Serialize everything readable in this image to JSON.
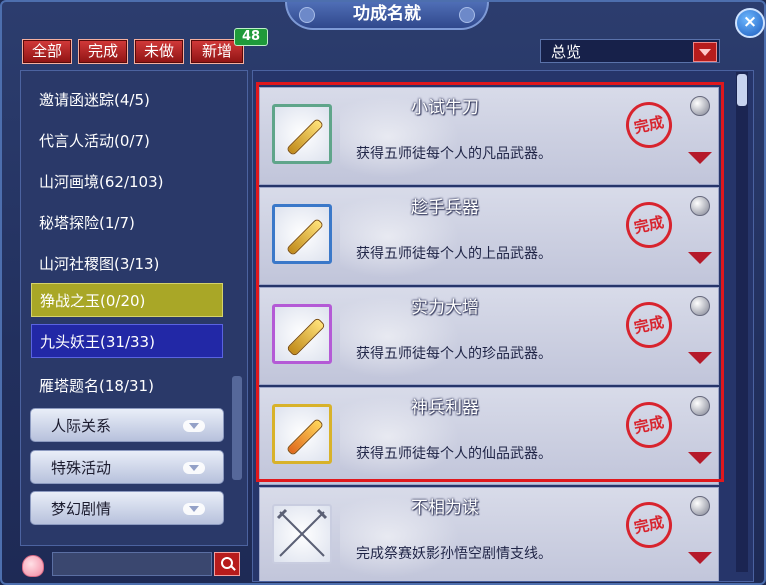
{
  "window": {
    "title": "功成名就"
  },
  "tabs": [
    {
      "label": "全部"
    },
    {
      "label": "完成"
    },
    {
      "label": "未做"
    },
    {
      "label": "新增"
    }
  ],
  "new_count": "48",
  "filter": {
    "selected": "总览"
  },
  "sidebar": {
    "items": [
      {
        "label": "邀请函迷踪(4/5)"
      },
      {
        "label": "代言人活动(0/7)"
      },
      {
        "label": "山河画境(62/103)"
      },
      {
        "label": "秘塔探险(1/7)"
      },
      {
        "label": "山河社稷图(3/13)"
      },
      {
        "label": "狰战之玉(0/20)",
        "highlight": "yellow"
      },
      {
        "label": "九头妖王(31/33)",
        "highlight": "blue"
      },
      {
        "label": "雁塔题名(18/31)"
      }
    ],
    "categories": [
      {
        "label": "人际关系"
      },
      {
        "label": "特殊活动"
      },
      {
        "label": "梦幻剧情"
      }
    ]
  },
  "search": {
    "value": ""
  },
  "achievements": [
    {
      "name": "小试牛刀",
      "desc": "获得五师徒每个人的凡品武器。",
      "stamp": "完成",
      "icon": "green-wooden-staff-icon",
      "frame": "#5fa58a"
    },
    {
      "name": "趁手兵器",
      "desc": "获得五师徒每个人的上品武器。",
      "stamp": "完成",
      "icon": "blue-wooden-staff-icon",
      "frame": "#3a78c9"
    },
    {
      "name": "实力大增",
      "desc": "获得五师徒每个人的珍品武器。",
      "stamp": "完成",
      "icon": "purple-golden-club-icon",
      "frame": "#b45ad6"
    },
    {
      "name": "神兵利器",
      "desc": "获得五师徒每个人的仙品武器。",
      "stamp": "完成",
      "icon": "golden-flame-staff-icon",
      "frame": "#d8b22a"
    },
    {
      "name": "不相为谋",
      "desc": "完成祭赛妖影孙悟空剧情支线。",
      "stamp": "完成",
      "icon": "crossed-swords-icon",
      "frame": "#c9cde0"
    }
  ]
}
